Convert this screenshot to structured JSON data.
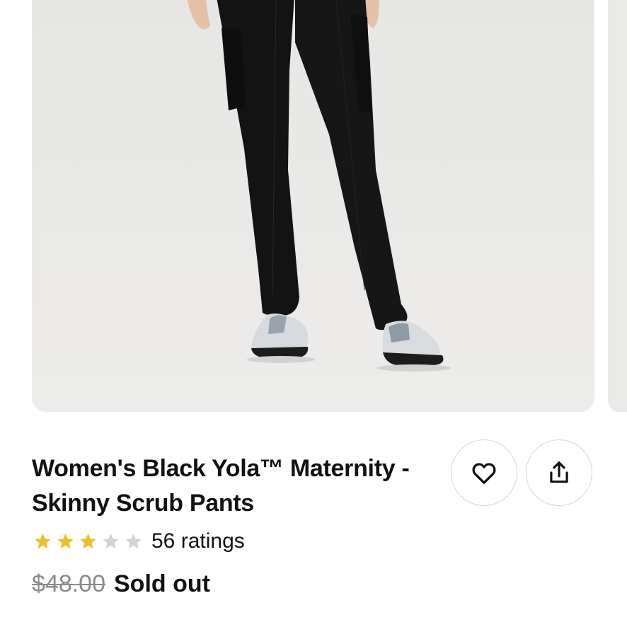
{
  "product": {
    "title": "Women's Black Yola™ Maternity - Skinny Scrub Pants",
    "rating": 3,
    "rating_max": 5,
    "ratings_count_text": "56 ratings",
    "original_price": "$48.00",
    "availability": "Sold out"
  },
  "actions": {
    "favorite_icon": "heart-icon",
    "share_icon": "share-icon"
  },
  "colors": {
    "star_filled": "#e8c12a",
    "star_empty": "#d3d3d3",
    "image_background": "#eaeae9",
    "strikethrough_price": "#8a8a8a"
  }
}
